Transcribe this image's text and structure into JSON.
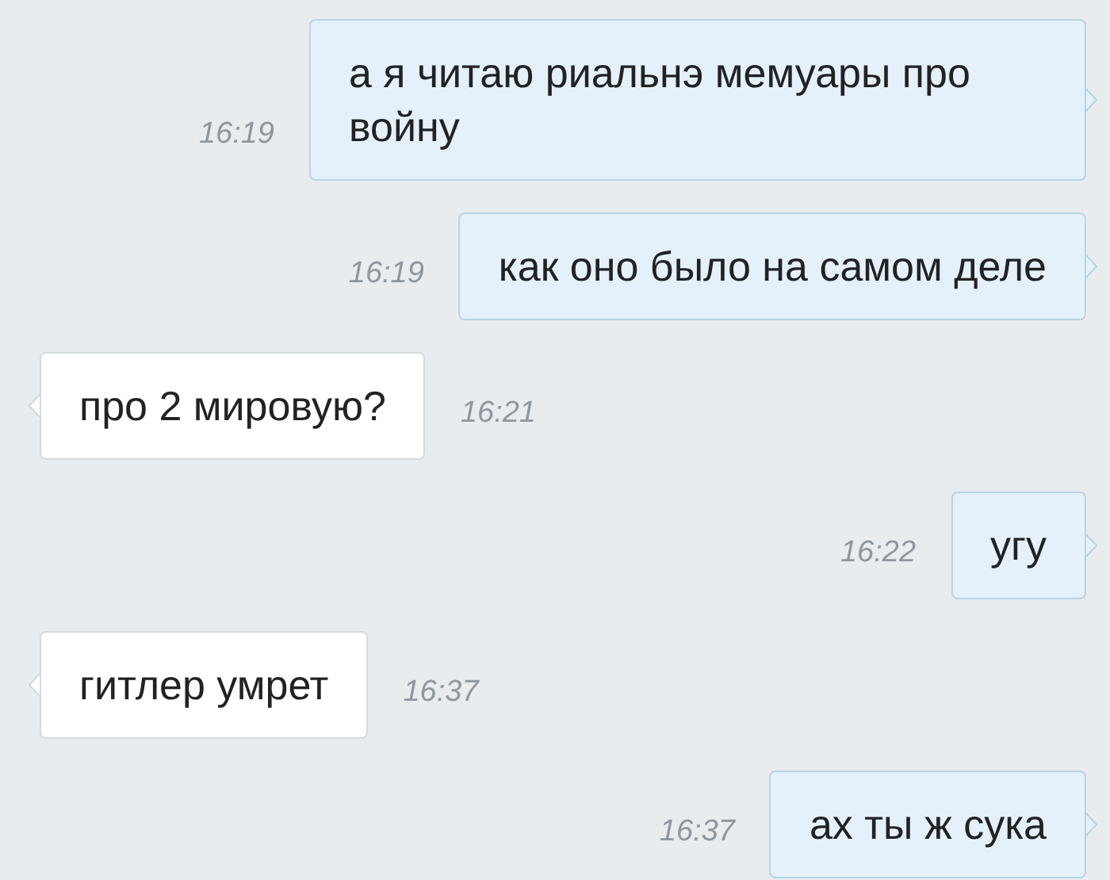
{
  "messages": [
    {
      "kind": "outgoing",
      "text": "а я читаю риальнэ мемуары про войну",
      "time": "16:19"
    },
    {
      "kind": "outgoing",
      "text": "как оно было на самом деле",
      "time": "16:19"
    },
    {
      "kind": "incoming",
      "text": "про 2 мировую?",
      "time": "16:21"
    },
    {
      "kind": "outgoing",
      "text": "угу",
      "time": "16:22"
    },
    {
      "kind": "incoming",
      "text": "гитлер умрет",
      "time": "16:37"
    },
    {
      "kind": "outgoing",
      "text": "ах ты ж сука",
      "time": "16:37"
    }
  ]
}
